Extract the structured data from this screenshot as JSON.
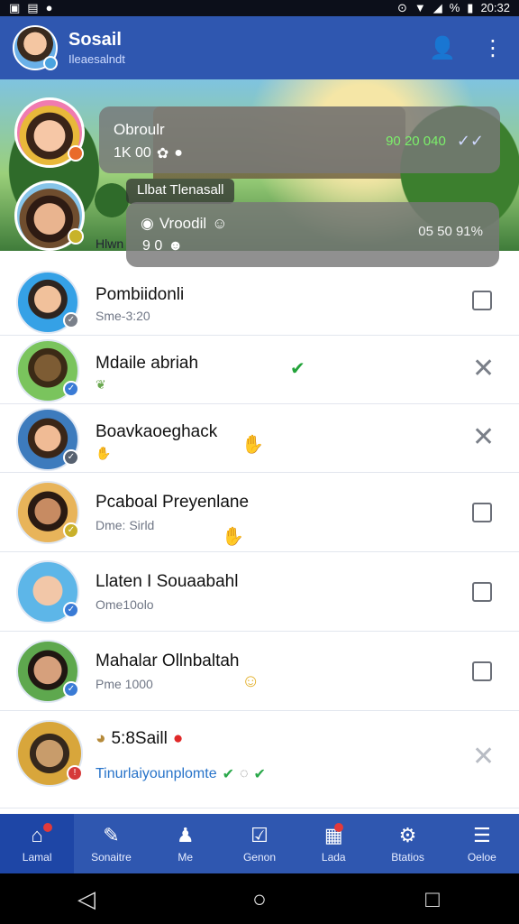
{
  "status_bar": {
    "time": "20:32",
    "battery": "%"
  },
  "header": {
    "title": "Sosail",
    "subtitle": "Ileaesalndt"
  },
  "banner": {
    "card1": {
      "title": "Obroulr",
      "sub": "1K 00",
      "right": "90 20 040"
    },
    "tag": "Llbat Tlenasall",
    "card2": {
      "title": "Vroodil",
      "sub": "9 0",
      "right": "05 50 91%"
    },
    "partial": "Hlwn"
  },
  "contacts": [
    {
      "name": "Pombiidonli",
      "sub": "Sme-3:20",
      "action": "checkbox"
    },
    {
      "name": "Mdaile abriah",
      "sub": "",
      "action": "x"
    },
    {
      "name": "Boavkaoeghack",
      "sub": "",
      "action": "x"
    },
    {
      "name": "Pcaboal Preyenlane",
      "sub": "Dme: Sirld",
      "action": "checkbox"
    },
    {
      "name": "Llaten I Souaabahl",
      "sub": "Ome10olo",
      "action": "checkbox"
    },
    {
      "name": "Mahalar Ollnbaltah",
      "sub": "Pme 1000",
      "action": "checkbox"
    },
    {
      "name": "5:8Saill",
      "sub": "Tinurlaiyounplomte",
      "action": "x-dotted"
    }
  ],
  "bottom_nav": [
    {
      "label": "Lamal",
      "icon": "home-icon",
      "active": true
    },
    {
      "label": "Sonaitre",
      "icon": "edit-icon"
    },
    {
      "label": "Me",
      "icon": "person-icon"
    },
    {
      "label": "Genon",
      "icon": "check-box-icon"
    },
    {
      "label": "Lada",
      "icon": "calendar-icon"
    },
    {
      "label": "Btatios",
      "icon": "settings-icon"
    },
    {
      "label": "Oeloe",
      "icon": "menu-icon"
    }
  ]
}
